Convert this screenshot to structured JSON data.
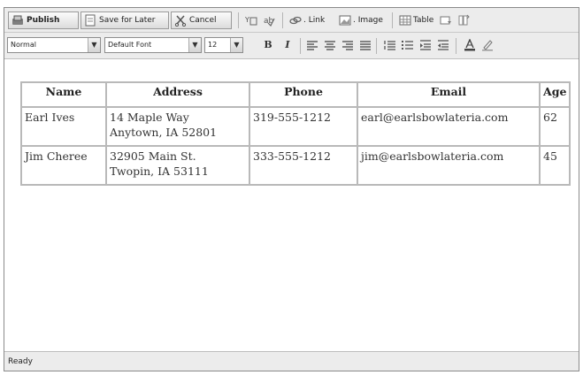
{
  "toolbar": {
    "publish_label": "Publish",
    "save_later_label": "Save for Later",
    "cancel_label": "Cancel",
    "link_label": ". Link",
    "image_label": ". Image",
    "table_label": "Table"
  },
  "format_bar": {
    "style_value": "Normal",
    "font_value": "Default Font",
    "size_value": "12",
    "bold_glyph": "B",
    "italic_glyph": "I"
  },
  "table": {
    "headers": [
      "Name",
      "Address",
      "Phone",
      "Email",
      "Age"
    ],
    "rows": [
      {
        "name": "Earl Ives",
        "address_line1": "14 Maple Way",
        "address_line2": "Anytown, IA 52801",
        "phone": "319-555-1212",
        "email": "earl@earlsbowlateria.com",
        "age": "62"
      },
      {
        "name": "Jim Cheree",
        "address_line1": "32905 Main St.",
        "address_line2": "Twopin, IA 53111",
        "phone": "333-555-1212",
        "email": "jim@earlsbowlateria.com",
        "age": "45"
      }
    ]
  },
  "status_bar": {
    "text": "Ready"
  },
  "colors": {
    "toolbar_bg": "#ececec",
    "grid_border": "#b9b9b9",
    "window_border": "#8a8a8a"
  }
}
